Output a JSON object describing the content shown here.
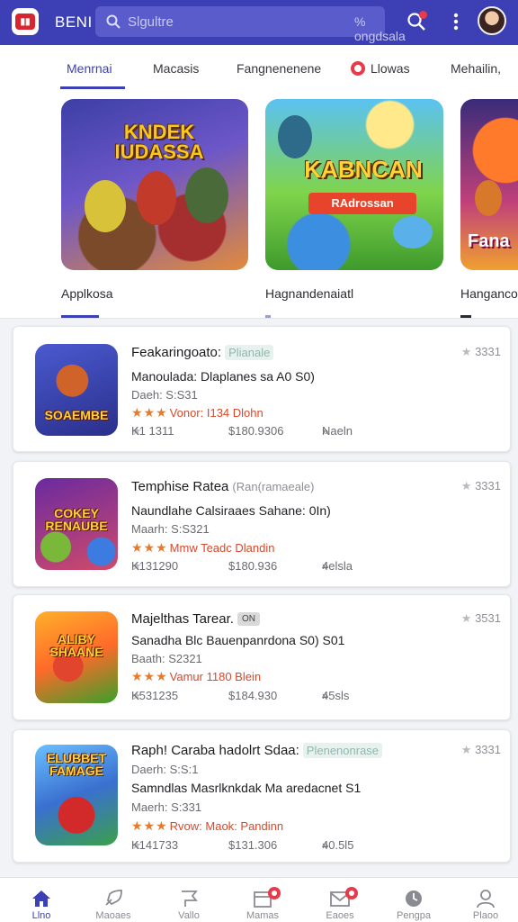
{
  "header": {
    "brand": "BENI",
    "search_placeholder": "Slgultre",
    "search_hint": "% ongdsala canoselre",
    "icons": [
      "logo",
      "search-icon",
      "notification-dot",
      "more-vert-icon",
      "avatar"
    ]
  },
  "tabs": [
    {
      "label": "Menrnai",
      "active": true
    },
    {
      "label": "Macasis"
    },
    {
      "label": "Fangnenenene"
    },
    {
      "label": "Llowas",
      "badge": true
    },
    {
      "label": "Mehailin,"
    }
  ],
  "featured": [
    {
      "art_title": "KNDEK IUDASSA",
      "caption": "Applkosa"
    },
    {
      "art_title": "KABNCAN",
      "art_sub": "RAdrossan",
      "caption": "Hagnandenaiatl"
    },
    {
      "art_title": "Fana",
      "caption": "Hanganco"
    }
  ],
  "apps": [
    {
      "icon_text": "SOAEMBE",
      "title": "Feakaringoato:",
      "tag": "Plianale",
      "tag_style": "mint",
      "line": "Manoulada: Dlaplanes sa A0 S0)",
      "meta": "Daeh: S:S31",
      "rating_stars": 3,
      "rating_text": "Vonor: I134 Dlohn",
      "stats": [
        "K1 1311",
        "$180.9306",
        "Naeln"
      ],
      "score": "3331"
    },
    {
      "icon_text": "COKEY RENAUBE",
      "title": "Temphise Ratea",
      "tag": "(Ran(ramaeale)",
      "tag_style": "plain",
      "line": "Naundlahe Calsiraaes Sahane: 0In)",
      "meta": "Maarh: S:S321",
      "rating_stars": 3,
      "rating_text": "Mmw  Teadc Dlandin",
      "stats": [
        "K131290",
        "$180.936",
        "4elsla"
      ],
      "score": "3331"
    },
    {
      "icon_text": "ALIBY SHAANE",
      "title": "Majelthas Tarear.",
      "tag": "ON",
      "tag_style": "dark",
      "line": "Sanadha Blc Bauenpanrdona S0) S01",
      "meta": "Baath: S2321",
      "rating_stars": 3,
      "rating_text": "Vamur 1180 Blein",
      "stats": [
        "K531235",
        "$184.930",
        "45sls"
      ],
      "score": "3531"
    },
    {
      "icon_text": "ELUBBET FAMAGE",
      "title": "Raph! Caraba hadolrt Sdaa:",
      "tag": "Plenenonrase",
      "tag_style": "mint",
      "line": "Samndlas Masrlknkdak Ma aredacnet S1",
      "meta": "Daerh: S:S:1",
      "meta2": "Maerh: S:331",
      "rating_stars": 3,
      "rating_text": "Rvow: Maok: Pandinn",
      "stats": [
        "K141733",
        "$131.306",
        "40.5l5"
      ],
      "score": "3331"
    }
  ],
  "bottom_nav": [
    {
      "label": "Llno",
      "icon": "home-icon",
      "active": true
    },
    {
      "label": "Maoaes",
      "icon": "rocket-icon"
    },
    {
      "label": "Vallo",
      "icon": "flag-icon"
    },
    {
      "label": "Mamas",
      "icon": "calendar-icon",
      "badge": true
    },
    {
      "label": "Eaoes",
      "icon": "mail-icon",
      "badge": true
    },
    {
      "label": "Pengpa",
      "icon": "clock-icon"
    },
    {
      "label": "Plaoo",
      "icon": "person-icon"
    }
  ],
  "colors": {
    "primary": "#3d3fb4",
    "accent_red": "#e83a4a",
    "rating_orange": "#d9482a",
    "background": "#f2f3f6"
  }
}
